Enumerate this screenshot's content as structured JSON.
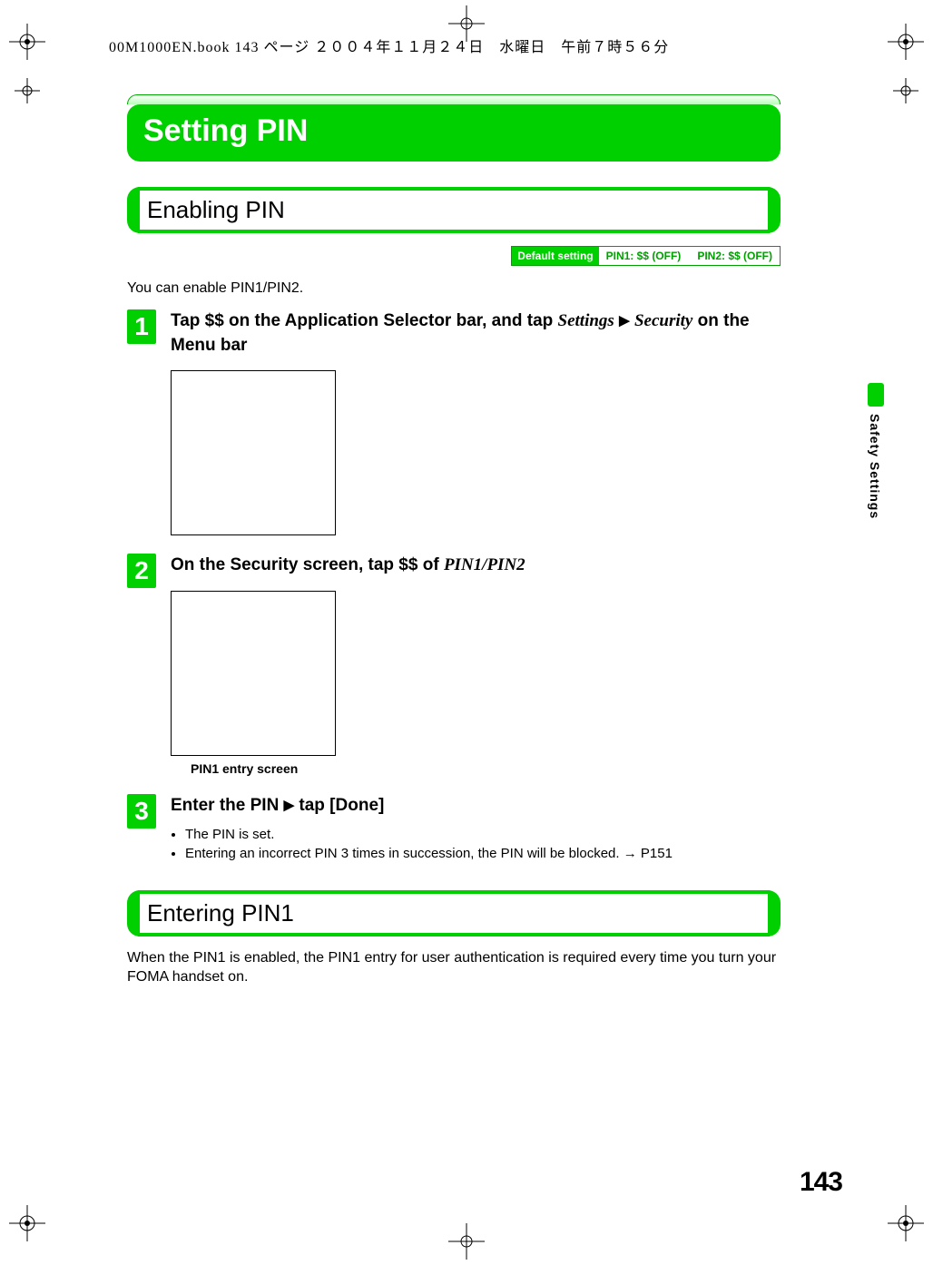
{
  "header_line": "00M1000EN.book  143 ページ  ２００４年１１月２４日　水曜日　午前７時５６分",
  "main_title": "Setting PIN",
  "section_enabling": {
    "heading": "Enabling PIN",
    "default_label": "Default setting",
    "default_values": [
      "PIN1: $$ (OFF)",
      "PIN2: $$ (OFF)"
    ],
    "intro": "You can enable PIN1/PIN2.",
    "steps": [
      {
        "num": "1",
        "title_parts": {
          "pre": "Tap $$ on the Application Selector bar, and tap ",
          "ital1": "Settings",
          "arrow": "▶",
          "ital2": "Security",
          "post": " on the Menu bar"
        }
      },
      {
        "num": "2",
        "title_parts": {
          "pre": "On the Security screen, tap $$ of ",
          "ital1": "PIN1/PIN2"
        },
        "caption": "PIN1 entry screen"
      },
      {
        "num": "3",
        "title_parts": {
          "pre": "Enter the PIN ",
          "arrow": "▶",
          "post": " tap [Done]"
        },
        "bullets": [
          "The PIN is set.",
          "Entering an incorrect PIN 3 times in succession, the PIN will be blocked. → P151"
        ]
      }
    ]
  },
  "section_entering": {
    "heading": "Entering PIN1",
    "body": "When the PIN1 is enabled, the PIN1 entry for user authentication is required every time you turn your FOMA handset on."
  },
  "side_tab_label": "Safety Settings",
  "page_number": "143"
}
